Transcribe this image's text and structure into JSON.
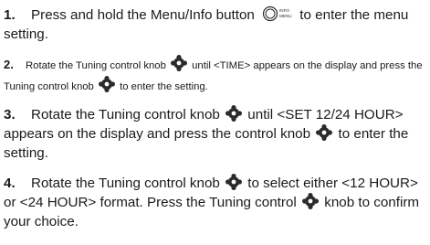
{
  "steps": [
    {
      "number": "1.",
      "parts": [
        "Press and hold the Menu/Info button",
        "to enter the menu setting."
      ],
      "icons": [
        "menu-info-button-icon"
      ]
    },
    {
      "number": "2.",
      "parts": [
        "Rotate the Tuning control knob",
        "until <TIME> appears on the display and press the Tuning control knob",
        "to enter the setting."
      ],
      "icons": [
        "tuning-knob-icon",
        "tuning-knob-icon"
      ]
    },
    {
      "number": "3.",
      "parts": [
        "Rotate the Tuning control knob",
        "until <SET 12/24 HOUR> appears on the display and press the control knob",
        "to enter the setting."
      ],
      "icons": [
        "tuning-knob-icon",
        "tuning-knob-icon"
      ]
    },
    {
      "number": "4.",
      "parts": [
        "Rotate the Tuning control knob",
        "to select either <12 HOUR> or <24 HOUR> format. Press the Tuning control",
        "knob to confirm your choice."
      ],
      "icons": [
        "tuning-knob-icon",
        "tuning-knob-icon"
      ]
    }
  ],
  "menu_button_icon_text": {
    "line1": "INFO",
    "line2": "MENU"
  },
  "colors": {
    "text": "#1a1a1a",
    "icon": "#2b2b2b"
  }
}
